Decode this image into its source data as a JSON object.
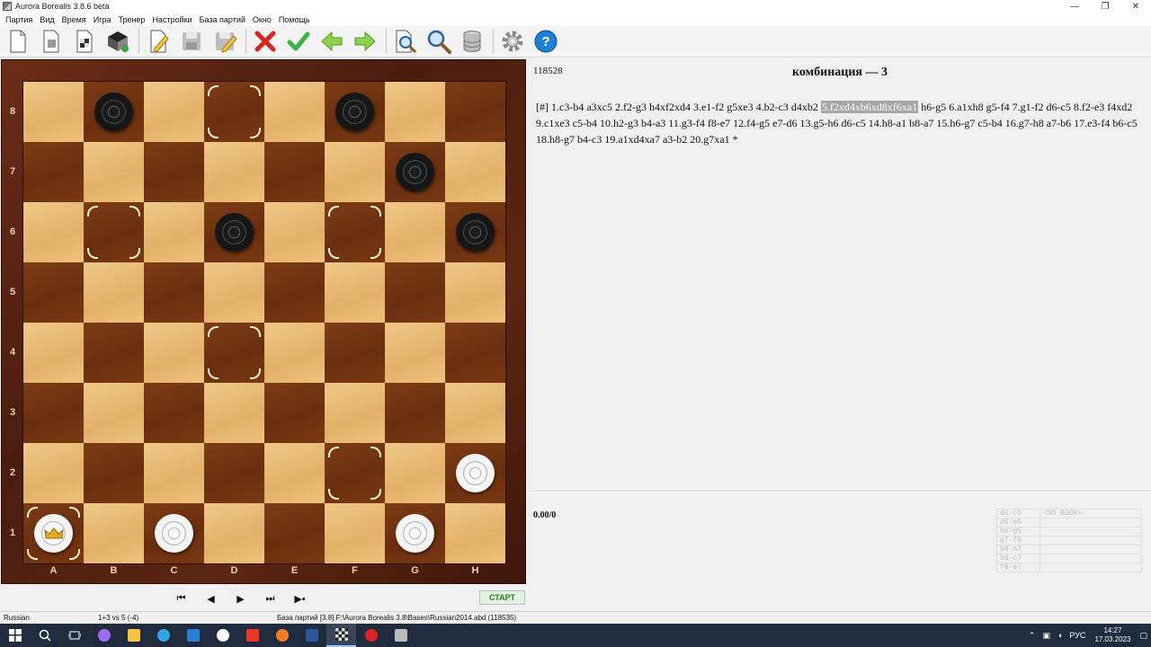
{
  "window": {
    "title": "Aurora Borealis 3.8.6 beta",
    "controls": [
      "—",
      "❐",
      "✕"
    ]
  },
  "menu": [
    "Партия",
    "Вид",
    "Время",
    "Игра",
    "Тренер",
    "Настройки",
    "База партий",
    "Окно",
    "Помощь"
  ],
  "toolbar": {
    "icons": [
      "new-document-icon",
      "open-game-icon",
      "board-icon",
      "checkered-board-icon",
      "edit-pencil-icon",
      "save-disk-icon",
      "save-as-icon",
      "delete-x-icon",
      "accept-check-icon",
      "back-arrow-icon",
      "forward-arrow-icon",
      "search-board-icon",
      "magnifier-icon",
      "database-icon",
      "settings-gear-icon",
      "help-icon"
    ]
  },
  "board": {
    "ranks": [
      "8",
      "7",
      "6",
      "5",
      "4",
      "3",
      "2",
      "1"
    ],
    "files": [
      "A",
      "B",
      "C",
      "D",
      "E",
      "F",
      "G",
      "H"
    ],
    "pieces": [
      {
        "square": "b8",
        "color": "black",
        "king": false
      },
      {
        "square": "f8",
        "color": "black",
        "king": false
      },
      {
        "square": "g7",
        "color": "black",
        "king": false
      },
      {
        "square": "d6",
        "color": "black",
        "king": false
      },
      {
        "square": "h6",
        "color": "black",
        "king": false
      },
      {
        "square": "h2",
        "color": "white",
        "king": false
      },
      {
        "square": "a1",
        "color": "white",
        "king": true
      },
      {
        "square": "c1",
        "color": "white",
        "king": false
      },
      {
        "square": "g1",
        "color": "white",
        "king": false
      }
    ],
    "marked_squares": [
      "d8",
      "b6",
      "f6",
      "d4",
      "f2",
      "a1"
    ],
    "colors": {
      "light": "#e8bb78",
      "dark": "#743512",
      "frame": "#5a2410"
    }
  },
  "navigation": {
    "buttons": [
      "⏮",
      "◀",
      "▶",
      "⏭",
      "▶•"
    ],
    "start_label": "СТАРТ"
  },
  "game": {
    "id": "118528",
    "title": "комбинация — 3",
    "notation_before": "[#] 1.c3-b4 a3xc5 2.f2-g3 h4xf2xd4 3.e1-f2 g5xe3 4.b2-c3 d4xb2 ",
    "notation_highlight": "5.f2xd4xb6xd8xf6xa1",
    "notation_after": " h6-g5 6.a1xh8 g5-f4 7.g1-f2 d6-c5 8.f2-e3 f4xd2 9.c1xe3 c5-b4 10.h2-g3 b4-a3 11.g3-f4 f8-e7 12.f4-g5 e7-d6 13.g5-h6 d6-c5 14.h8-a1 b8-a7 15.h6-g7 c5-b4 16.g7-h8 a7-b6 17.e3-f4 b6-c5 18.h8-g7 b4-c3 19.a1xd4xa7 a3-b2 20.g7xa1  *"
  },
  "engine": {
    "score": "0.00/0",
    "book_moves": [
      "d6-c5",
      "d6-e5",
      "h6-g5",
      "g7-f6",
      "b8-a7",
      "b8-c7",
      "f8-e7"
    ],
    "book_label": "<NO BOOK>"
  },
  "status": {
    "language": "Russian",
    "material": "1+3 vs 5  (-4)",
    "database": "База партий [3.8] F:\\Aurora Borealis 3.8\\Bases\\Russian2014.abd (118535)"
  },
  "taskbar": {
    "tray_lang": "РУС",
    "time": "14:27",
    "date": "17.03.2023"
  }
}
